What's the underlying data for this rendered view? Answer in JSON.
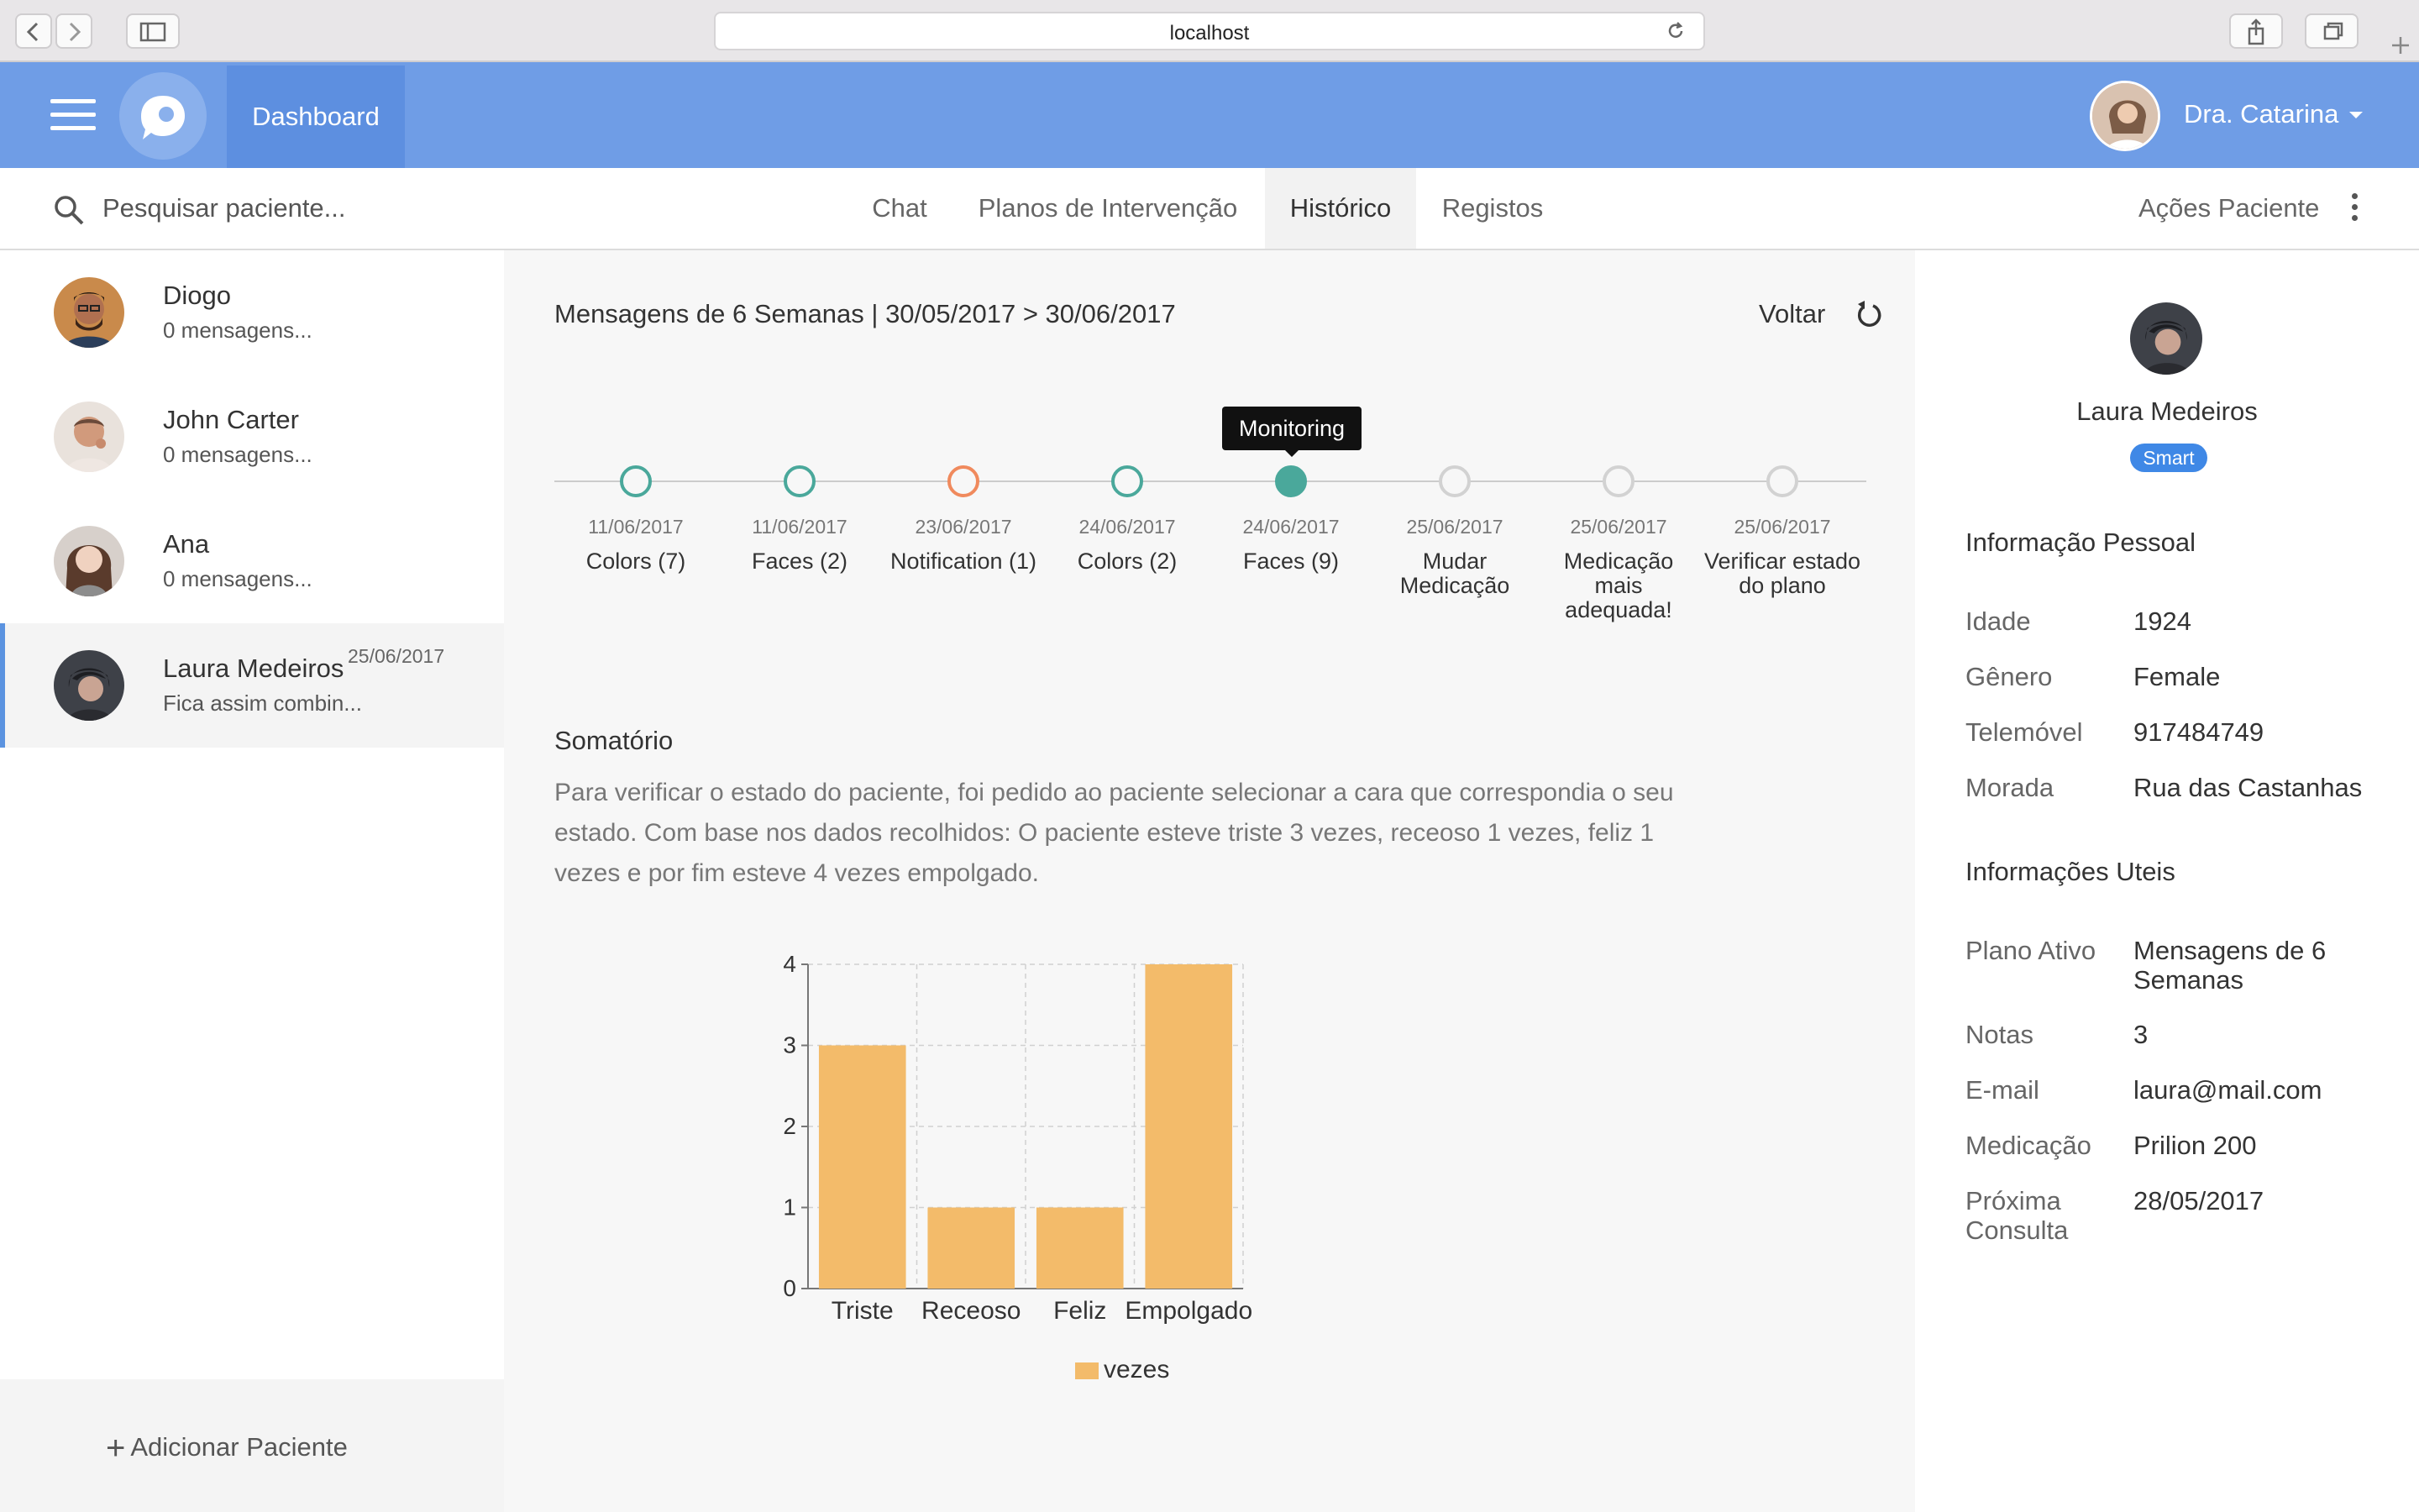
{
  "browser": {
    "url": "localhost"
  },
  "header": {
    "dashboard_label": "Dashboard",
    "user_name": "Dra. Catarina"
  },
  "subnav": {
    "search_placeholder": "Pesquisar paciente...",
    "tabs": [
      "Chat",
      "Planos de Intervenção",
      "Histórico",
      "Registos"
    ],
    "active_tab": "Histórico",
    "actions_label": "Ações Paciente"
  },
  "patients": [
    {
      "name": "Diogo",
      "message": "0 mensagens...",
      "date": ""
    },
    {
      "name": "John Carter",
      "message": "0 mensagens...",
      "date": ""
    },
    {
      "name": "Ana",
      "message": "0 mensagens...",
      "date": ""
    },
    {
      "name": "Laura Medeiros",
      "message": "Fica assim combin...",
      "date": "25/06/2017"
    }
  ],
  "sidebar": {
    "add_patient": "Adicionar Paciente"
  },
  "main": {
    "title": "Mensagens de 6 Semanas | 30/05/2017 > 30/06/2017",
    "back_label": "Voltar",
    "timeline": [
      {
        "date": "11/06/2017",
        "label": "Colors (7)",
        "status": "done"
      },
      {
        "date": "11/06/2017",
        "label": "Faces (2)",
        "status": "done"
      },
      {
        "date": "23/06/2017",
        "label": "Notification (1)",
        "status": "warning"
      },
      {
        "date": "24/06/2017",
        "label": "Colors (2)",
        "status": "done"
      },
      {
        "date": "24/06/2017",
        "label": "Faces (9)",
        "status": "active"
      },
      {
        "date": "25/06/2017",
        "label": "Mudar Medicação",
        "status": "pending"
      },
      {
        "date": "25/06/2017",
        "label": "Medicação mais adequada!",
        "status": "pending"
      },
      {
        "date": "25/06/2017",
        "label": "Verificar estado do plano",
        "status": "pending"
      }
    ],
    "tooltip": "Monitoring",
    "summary_title": "Somatório",
    "summary_text": "Para verificar o estado do paciente, foi pedido ao paciente selecionar a cara que correspondia o seu estado. Com base nos dados recolhidos: O paciente esteve triste 3 vezes, receoso 1 vezes, feliz 1 vezes e por fim esteve 4 vezes empolgado."
  },
  "chart_data": {
    "type": "bar",
    "categories": [
      "Triste",
      "Receoso",
      "Feliz",
      "Empolgado"
    ],
    "series": [
      {
        "name": "vezes",
        "values": [
          3,
          1,
          1,
          4
        ]
      }
    ],
    "ylim": [
      0,
      4
    ],
    "yticks": [
      0,
      1,
      2,
      3,
      4
    ],
    "grid": true,
    "legend": "bottom",
    "bar_color": "#f3bb6a"
  },
  "profile": {
    "name": "Laura Medeiros",
    "badge": "Smart",
    "personal_title": "Informação Pessoal",
    "personal": [
      {
        "label": "Idade",
        "value": "1924"
      },
      {
        "label": "Gênero",
        "value": "Female"
      },
      {
        "label": "Telemóvel",
        "value": "917484749"
      },
      {
        "label": "Morada",
        "value": "Rua das Castanhas"
      }
    ],
    "useful_title": "Informações Uteis",
    "useful": [
      {
        "label": "Plano Ativo",
        "value": "Mensagens de 6 Semanas"
      },
      {
        "label": "Notas",
        "value": "3"
      },
      {
        "label": "E-mail",
        "value": "laura@mail.com"
      },
      {
        "label": "Medicação",
        "value": "Prilion 200"
      },
      {
        "label": "Próxima Consulta",
        "value": "28/05/2017"
      }
    ]
  },
  "colors": {
    "header": "#6f9de6",
    "accent": "#4aa89b",
    "warning": "#f08a5d",
    "badge": "#3f88e6"
  }
}
